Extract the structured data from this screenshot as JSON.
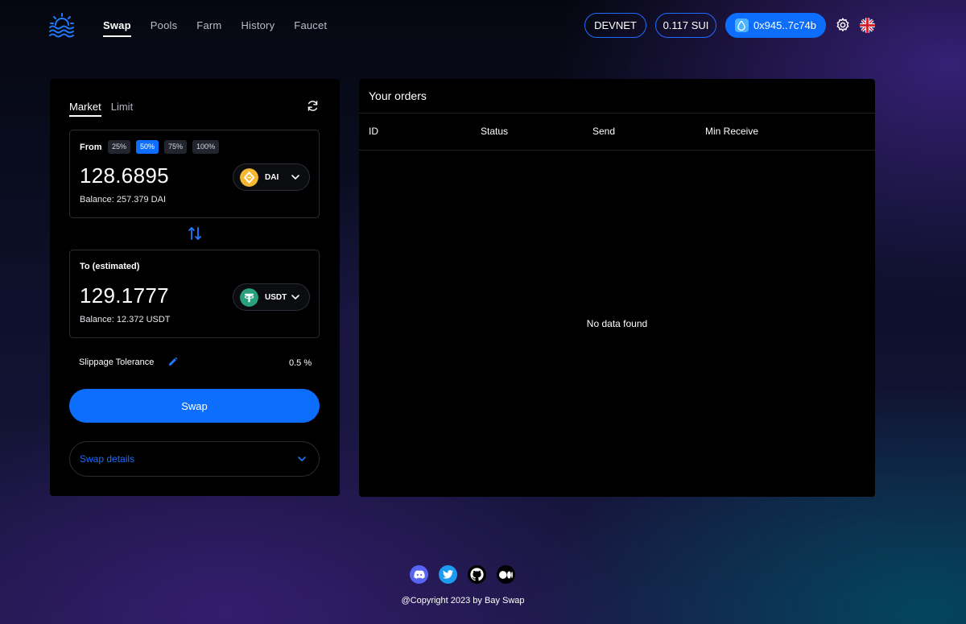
{
  "nav": {
    "items": [
      {
        "label": "Swap",
        "active": true
      },
      {
        "label": "Pools",
        "active": false
      },
      {
        "label": "Farm",
        "active": false
      },
      {
        "label": "History",
        "active": false
      },
      {
        "label": "Faucet",
        "active": false
      }
    ]
  },
  "header": {
    "network": "DEVNET",
    "balance": "0.117 SUI",
    "wallet": "0x945..7c74b"
  },
  "swap": {
    "tabs": [
      {
        "label": "Market",
        "active": true
      },
      {
        "label": "Limit",
        "active": false
      }
    ],
    "from": {
      "label": "From",
      "percents": [
        "25%",
        "50%",
        "75%",
        "100%"
      ],
      "active_percent": "50%",
      "amount": "128.6895",
      "balance": "Balance: 257.379 DAI",
      "token": "DAI"
    },
    "to": {
      "label": "To (estimated)",
      "amount": "129.1777",
      "balance": "Balance: 12.372 USDT",
      "token": "USDT"
    },
    "slippage_label": "Slippage Tolerance",
    "slippage_value": "0.5 %",
    "swap_button": "Swap",
    "details_label": "Swap details"
  },
  "orders": {
    "title": "Your orders",
    "columns": [
      "ID",
      "Status",
      "Send",
      "Min Receive"
    ],
    "empty_text": "No data found"
  },
  "footer": {
    "copyright": "@Copyright 2023 by Bay Swap"
  },
  "colors": {
    "accent": "#0d6efd",
    "dai": "#f4b731",
    "usdt": "#26a17b"
  }
}
